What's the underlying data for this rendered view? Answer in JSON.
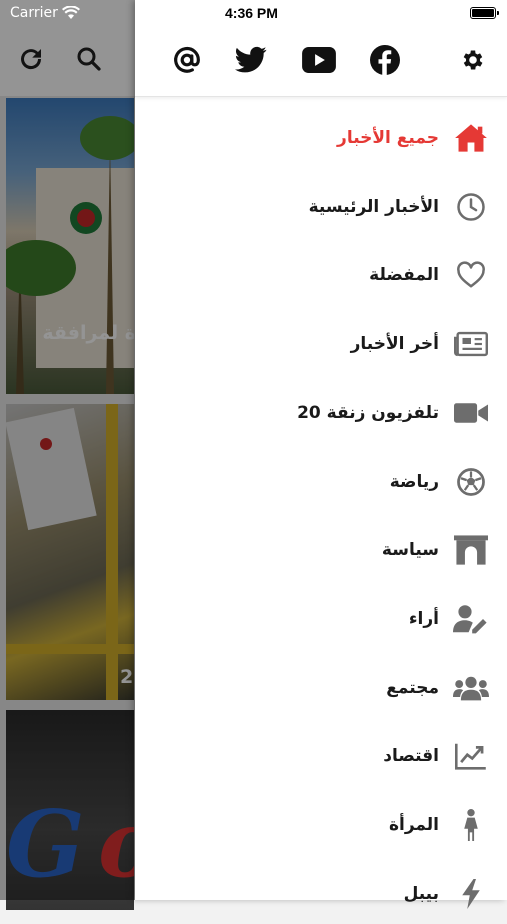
{
  "status_bar": {
    "carrier": "Carrier",
    "time": "4:36 PM"
  },
  "background": {
    "card1_caption": "ة لمرافقة",
    "card2_caption": "2",
    "card3_logo_letters": "Go"
  },
  "drawer": {
    "social_icons": [
      "at-icon",
      "twitter-icon",
      "youtube-icon",
      "facebook-icon",
      "gear-icon"
    ],
    "menu": [
      {
        "label": "جميع الأخبار",
        "icon": "home-icon",
        "active": true
      },
      {
        "label": "الأخبار الرئيسية",
        "icon": "clock-icon"
      },
      {
        "label": "المفضلة",
        "icon": "heart-icon"
      },
      {
        "label": "أخر الأخبار",
        "icon": "newspaper-icon"
      },
      {
        "label": "تلفزيون زنقة 20",
        "icon": "video-icon"
      },
      {
        "label": "رياضة",
        "icon": "soccer-ball-icon"
      },
      {
        "label": "سياسة",
        "icon": "arch-icon"
      },
      {
        "label": "أراء",
        "icon": "user-edit-icon"
      },
      {
        "label": "مجتمع",
        "icon": "users-icon"
      },
      {
        "label": "اقتصاد",
        "icon": "chart-icon"
      },
      {
        "label": "المرأة",
        "icon": "female-icon"
      },
      {
        "label": "بيبل",
        "icon": "bolt-icon"
      }
    ]
  },
  "colors": {
    "active": "#e53935",
    "icon_gray": "#6d6d6d",
    "text": "#1a1a1a"
  }
}
